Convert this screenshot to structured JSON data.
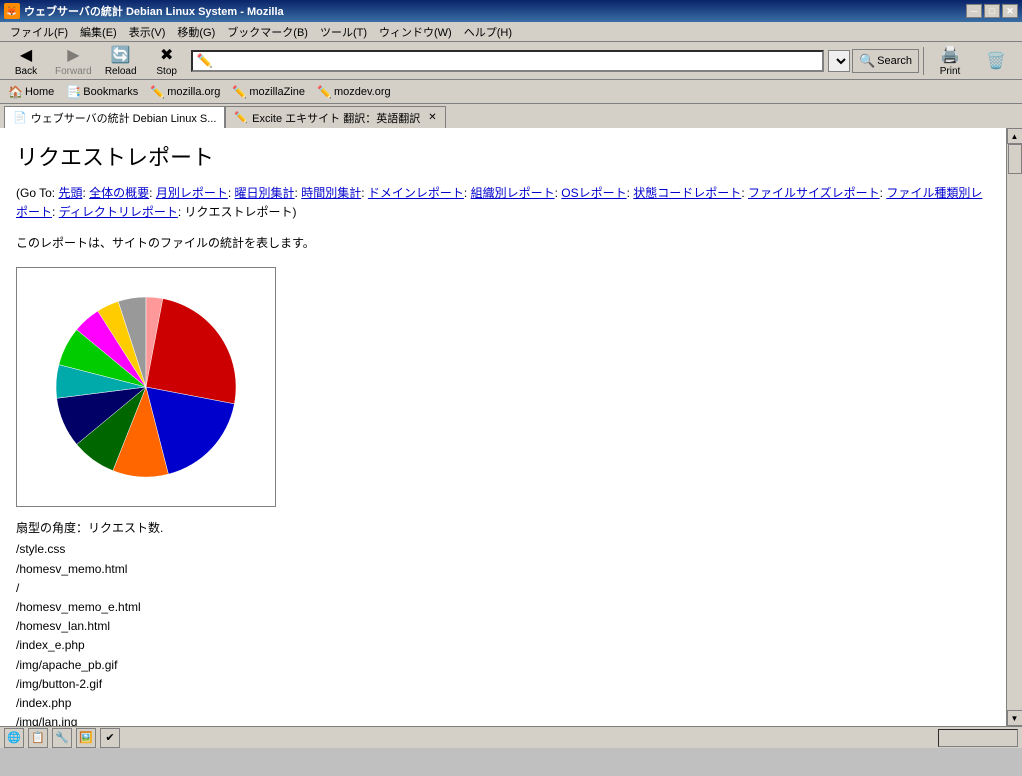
{
  "window": {
    "title": "ウェブサーバの統計 Debian Linux System - Mozilla",
    "icon": "🦊"
  },
  "title_bar": {
    "title": "ウェブサーバの統計 Debian Linux System - Mozilla",
    "minimize": "─",
    "maximize": "□",
    "close": "✕"
  },
  "menu": {
    "items": [
      "ファイル(F)",
      "編集(E)",
      "表示(V)",
      "移動(G)",
      "ブックマーク(B)",
      "ツール(T)",
      "ウィンドウ(W)",
      "ヘルプ(H)"
    ]
  },
  "toolbar": {
    "back": "Back",
    "forward": "Forward",
    "reload": "Reload",
    "stop": "Stop",
    "print": "Print",
    "search_label": "Search"
  },
  "address": {
    "url": ""
  },
  "bookmarks": {
    "items": [
      "Home",
      "Bookmarks",
      "mozilla.org",
      "mozillaZine",
      "mozdev.org"
    ]
  },
  "tabs": [
    {
      "label": "ウェブサーバの統計 Debian Linux S...",
      "active": true
    },
    {
      "label": "Excite エキサイト 翻訳：英語翻訳",
      "active": false
    }
  ],
  "page": {
    "title": "リクエストレポート",
    "nav_prefix": "(Go To: ",
    "nav_suffix": ")",
    "nav_links": [
      {
        "text": "先頭"
      },
      {
        "text": "全体の概要"
      },
      {
        "text": "月別レポート"
      },
      {
        "text": "曜日別集計"
      },
      {
        "text": "時間別集計"
      },
      {
        "text": "ドメインレポート"
      },
      {
        "text": "組織別レポート"
      },
      {
        "text": "OSレポート"
      },
      {
        "text": "状態コードレポート"
      },
      {
        "text": "ファイルサイズレポート"
      },
      {
        "text": "ファイル種類別レポート"
      },
      {
        "text": "ディレクトリレポート"
      },
      {
        "text": "リクエストレポート"
      }
    ],
    "description": "このレポートは、サイトのファイルの統計を表します。",
    "legend": "扇型の角度：リクエスト数.",
    "files": [
      "/style.css",
      "/homesv_memo.html",
      "/",
      "/homesv_memo_e.html",
      "/homesv_lan.html",
      "/index_e.php",
      "/img/apache_pb.gif",
      "/img/button-2.gif",
      "/index.php",
      "/img/lan.ing"
    ]
  },
  "status_bar": {
    "icons": [
      "🌐",
      "📄",
      "🔒",
      "🔧",
      "✔"
    ]
  },
  "pie_segments": [
    {
      "color": "#cc0000",
      "start": 0,
      "value": 28
    },
    {
      "color": "#0000cc",
      "start": 28,
      "value": 18
    },
    {
      "color": "#ff6600",
      "start": 46,
      "value": 10
    },
    {
      "color": "#006600",
      "start": 56,
      "value": 8
    },
    {
      "color": "#000066",
      "start": 64,
      "value": 9
    },
    {
      "color": "#00aaaa",
      "start": 73,
      "value": 6
    },
    {
      "color": "#00cc00",
      "start": 79,
      "value": 7
    },
    {
      "color": "#ff00ff",
      "start": 86,
      "value": 5
    },
    {
      "color": "#ffcc00",
      "start": 91,
      "value": 4
    },
    {
      "color": "#999999",
      "start": 95,
      "value": 5
    },
    {
      "color": "#ff9999",
      "start": 100,
      "value": 3
    }
  ]
}
